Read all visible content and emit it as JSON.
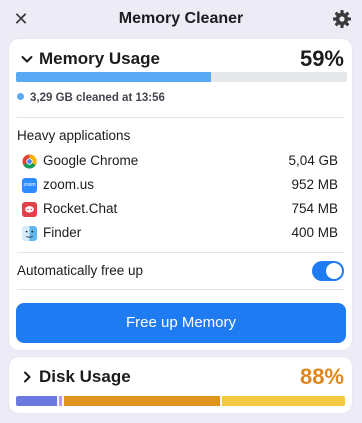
{
  "header": {
    "title": "Memory Cleaner",
    "close_icon": "close-icon",
    "settings_icon": "gear-icon"
  },
  "memory": {
    "title": "Memory Usage",
    "percent_label": "59%",
    "usage_fraction": 0.59,
    "fill_color": "#5aa9f5",
    "cleaned_text": "3,29 GB cleaned at 13:56",
    "heavy_label": "Heavy applications",
    "apps": [
      {
        "name": "Google Chrome",
        "size": "5,04 GB",
        "icon": "chrome-icon"
      },
      {
        "name": "zoom.us",
        "size": "952 MB",
        "icon": "zoom-icon"
      },
      {
        "name": "Rocket.Chat",
        "size": "754 MB",
        "icon": "rocketchat-icon"
      },
      {
        "name": "Finder",
        "size": "400 MB",
        "icon": "finder-icon"
      }
    ],
    "auto_free_label": "Automatically free up",
    "auto_free_enabled": true,
    "free_button_label": "Free up Memory"
  },
  "disk": {
    "title": "Disk Usage",
    "percent_label": "88%",
    "percent_color": "#e0861c",
    "segments": [
      {
        "fraction": 0.13,
        "color": "#6a78e0"
      },
      {
        "fraction": 0.015,
        "color": "#b99be6"
      },
      {
        "fraction": 0.48,
        "color": "#e0931e"
      },
      {
        "fraction": 0.375,
        "color": "#f5c842"
      }
    ]
  },
  "colors": {
    "accent": "#1f7bf2",
    "background": "#ecebf6"
  }
}
